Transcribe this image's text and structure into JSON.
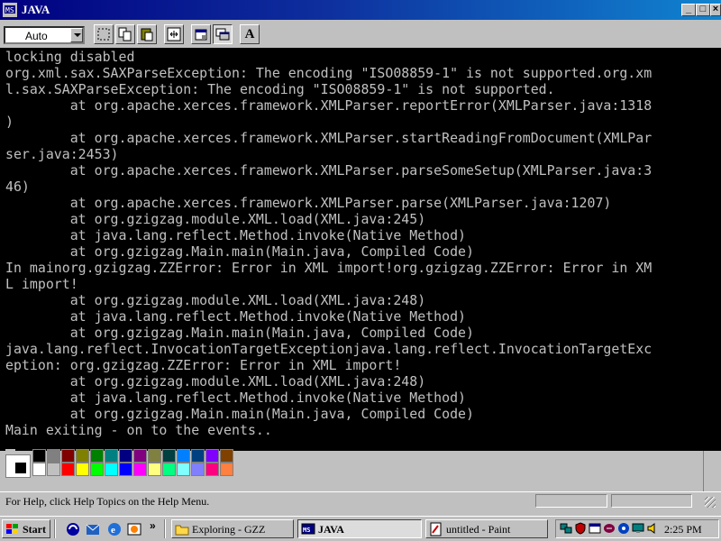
{
  "window": {
    "title": "JAVA",
    "minimize_label": "_",
    "maximize_label": "□",
    "close_label": "×"
  },
  "toolbar": {
    "font_size_value": "Auto",
    "font_button_label": "A"
  },
  "console": {
    "lines": [
      "locking disabled",
      "org.xml.sax.SAXParseException: The encoding \"ISO08859-1\" is not supported.org.xm",
      "l.sax.SAXParseException: The encoding \"ISO08859-1\" is not supported.",
      "        at org.apache.xerces.framework.XMLParser.reportError(XMLParser.java:1318",
      ")",
      "        at org.apache.xerces.framework.XMLParser.startReadingFromDocument(XMLPar",
      "ser.java:2453)",
      "        at org.apache.xerces.framework.XMLParser.parseSomeSetup(XMLParser.java:3",
      "46)",
      "        at org.apache.xerces.framework.XMLParser.parse(XMLParser.java:1207)",
      "        at org.gzigzag.module.XML.load(XML.java:245)",
      "        at java.lang.reflect.Method.invoke(Native Method)",
      "        at org.gzigzag.Main.main(Main.java, Compiled Code)",
      "In mainorg.gzigzag.ZZError: Error in XML import!org.gzigzag.ZZError: Error in XM",
      "L import!",
      "        at org.gzigzag.module.XML.load(XML.java:248)",
      "        at java.lang.reflect.Method.invoke(Native Method)",
      "        at org.gzigzag.Main.main(Main.java, Compiled Code)",
      "java.lang.reflect.InvocationTargetExceptionjava.lang.reflect.InvocationTargetExc",
      "eption: org.gzigzag.ZZError: Error in XML import!",
      "        at org.gzigzag.module.XML.load(XML.java:248)",
      "        at java.lang.reflect.Method.invoke(Native Method)",
      "        at org.gzigzag.Main.main(Main.java, Compiled Code)",
      "Main exiting - on to the events.."
    ]
  },
  "paint": {
    "palette_colors": [
      "#000000",
      "#808080",
      "#800000",
      "#808000",
      "#008000",
      "#008080",
      "#000080",
      "#800080",
      "#808040",
      "#004040",
      "#0080ff",
      "#004080",
      "#8000ff",
      "#804000",
      "#ffffff",
      "#c0c0c0",
      "#ff0000",
      "#ffff00",
      "#00ff00",
      "#00ffff",
      "#0000ff",
      "#ff00ff",
      "#ffff80",
      "#00ff80",
      "#80ffff",
      "#8080ff",
      "#ff0080",
      "#ff8040"
    ],
    "status_text": "For Help, click Help Topics on the Help Menu."
  },
  "taskbar": {
    "start_label": "Start",
    "quick_launch_more": "»",
    "tasks": [
      {
        "label": "Exploring - GZZ",
        "icon": "folder-icon"
      },
      {
        "label": "JAVA",
        "icon": "msdos-icon"
      },
      {
        "label": "untitled - Paint",
        "icon": "paint-icon"
      }
    ],
    "clock": "2:25 PM"
  },
  "colors": {
    "titlebar_start": "#000080",
    "titlebar_end": "#1084d0",
    "console_bg": "#000000",
    "console_fg": "#c0c0c0",
    "chrome": "#c0c0c0"
  }
}
